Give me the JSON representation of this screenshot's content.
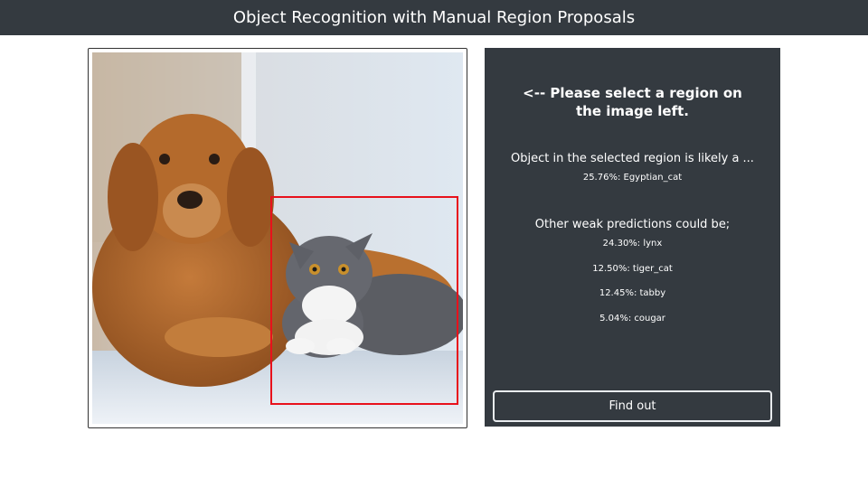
{
  "header": {
    "title": "Object Recognition with Manual Region Proposals"
  },
  "image": {
    "description_icon": "dog-and-cat-photo"
  },
  "panel": {
    "prompt": "<-- Please select a region on the image left.",
    "likely_title": "Object in the selected region is likely a ...",
    "top_prediction": "25.76%: Egyptian_cat",
    "weak_title": "Other weak predictions could be;",
    "weak_predictions": [
      "24.30%: lynx",
      "12.50%: tiger_cat",
      "12.45%: tabby",
      "5.04%: cougar"
    ],
    "button_label": "Find out"
  },
  "colors": {
    "header_bg": "#343a40",
    "panel_bg": "#343a40",
    "selection": "#e8111b"
  }
}
